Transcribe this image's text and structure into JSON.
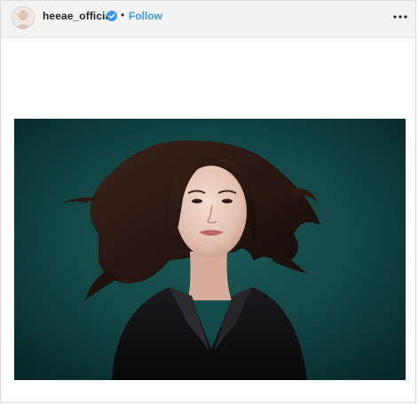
{
  "post": {
    "username": "heeae_official",
    "separator": "•",
    "follow_label": "Follow"
  },
  "icons": {
    "avatar": "profile-avatar",
    "verified": "verified-badge-icon",
    "more": "more-options-icon"
  },
  "colors": {
    "accent": "#3897f0",
    "verified": "#3897f0",
    "photo_background": "#0f3f3f"
  }
}
